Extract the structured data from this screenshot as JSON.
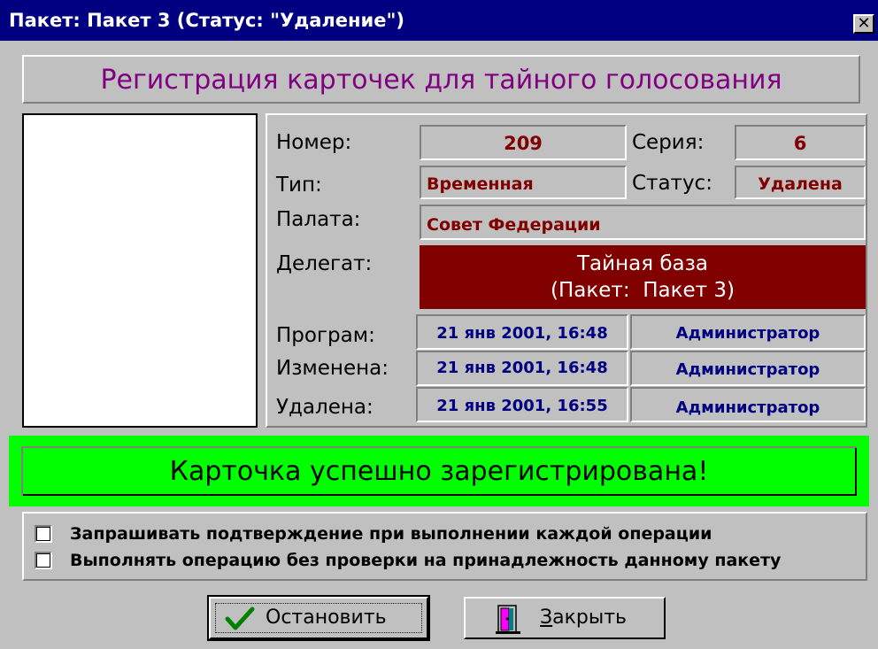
{
  "window": {
    "title": "Пакет: Пакет 3 (Статус: \"Удаление\")",
    "close_glyph": "✕"
  },
  "header": {
    "title": "Регистрация карточек для тайного голосования"
  },
  "card": {
    "number_label": "Номер:",
    "number_value": "209",
    "series_label": "Серия:",
    "series_value": "6",
    "type_label": "Тип:",
    "type_value": "Временная",
    "status_label": "Статус:",
    "status_value": "Удалена",
    "chamber_label": "Палата:",
    "chamber_value": "Совет Федерации",
    "delegate_label": "Делегат:",
    "delegate_line1": "Тайная база",
    "delegate_line2": "(Пакет:  Пакет 3)",
    "history": [
      {
        "label": "Програм:",
        "date": "21 янв 2001, 16:48",
        "user": "Администратор"
      },
      {
        "label": "Изменена:",
        "date": "21 янв 2001, 16:48",
        "user": "Администратор"
      },
      {
        "label": "Удалена:",
        "date": "21 янв 2001, 16:55",
        "user": "Администратор"
      }
    ]
  },
  "status_message": "Карточка успешно зарегистрирована!",
  "options": [
    {
      "label": "Запрашивать подтверждение при выполнении каждой операции",
      "checked": false
    },
    {
      "label": "Выполнять операцию без проверки на принадлежность данному пакету",
      "checked": false
    }
  ],
  "buttons": {
    "stop_label": "Остановить",
    "close_label": "Закрыть"
  },
  "colors": {
    "title_bar": "#000080",
    "header_text": "#800080",
    "value_red": "#800000",
    "value_blue": "#000080",
    "delegate_bg": "#800000",
    "success_bg": "#00ff00"
  },
  "icons": {
    "stop_button": "checkmark-icon",
    "close_button": "exit-door-icon",
    "title_close": "close-icon"
  }
}
